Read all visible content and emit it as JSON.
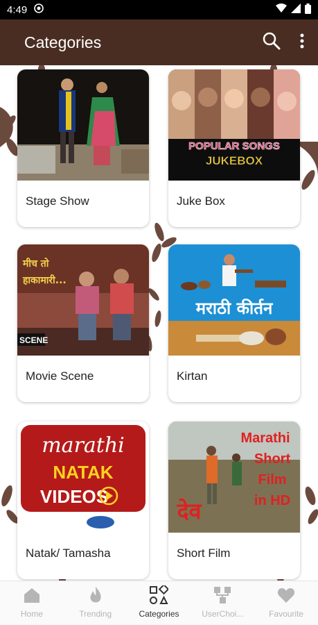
{
  "status_bar": {
    "time": "4:49"
  },
  "app_bar": {
    "title": "Categories"
  },
  "categories": [
    {
      "label": "Stage Show"
    },
    {
      "label": "Juke Box",
      "thumb_text": [
        "POPULAR SONGS",
        "JUKEBOX"
      ]
    },
    {
      "label": "Movie Scene",
      "thumb_text": [
        "मीच तो",
        "हाकामारी...",
        "SCENE"
      ]
    },
    {
      "label": "Kirtan",
      "thumb_text": [
        "मराठी कीर्तन"
      ]
    },
    {
      "label": "Natak/ Tamasha",
      "thumb_text": [
        "marathi",
        "NATAK",
        "VIDEOS"
      ]
    },
    {
      "label": "Short Film",
      "thumb_text": [
        "Marathi",
        "Short",
        "Film",
        "in HD",
        "देव"
      ]
    }
  ],
  "bottom_nav": [
    {
      "label": "Home",
      "icon": "home-icon"
    },
    {
      "label": "Trending",
      "icon": "flame-icon"
    },
    {
      "label": "Categories",
      "icon": "categories-icon",
      "active": true
    },
    {
      "label": "UserChoi...",
      "icon": "user-choice-icon"
    },
    {
      "label": "Favourite",
      "icon": "heart-icon"
    }
  ],
  "colors": {
    "app_bar": "#4a2d22",
    "accent_red": "#e02020",
    "deco": "#6b4a3e"
  }
}
